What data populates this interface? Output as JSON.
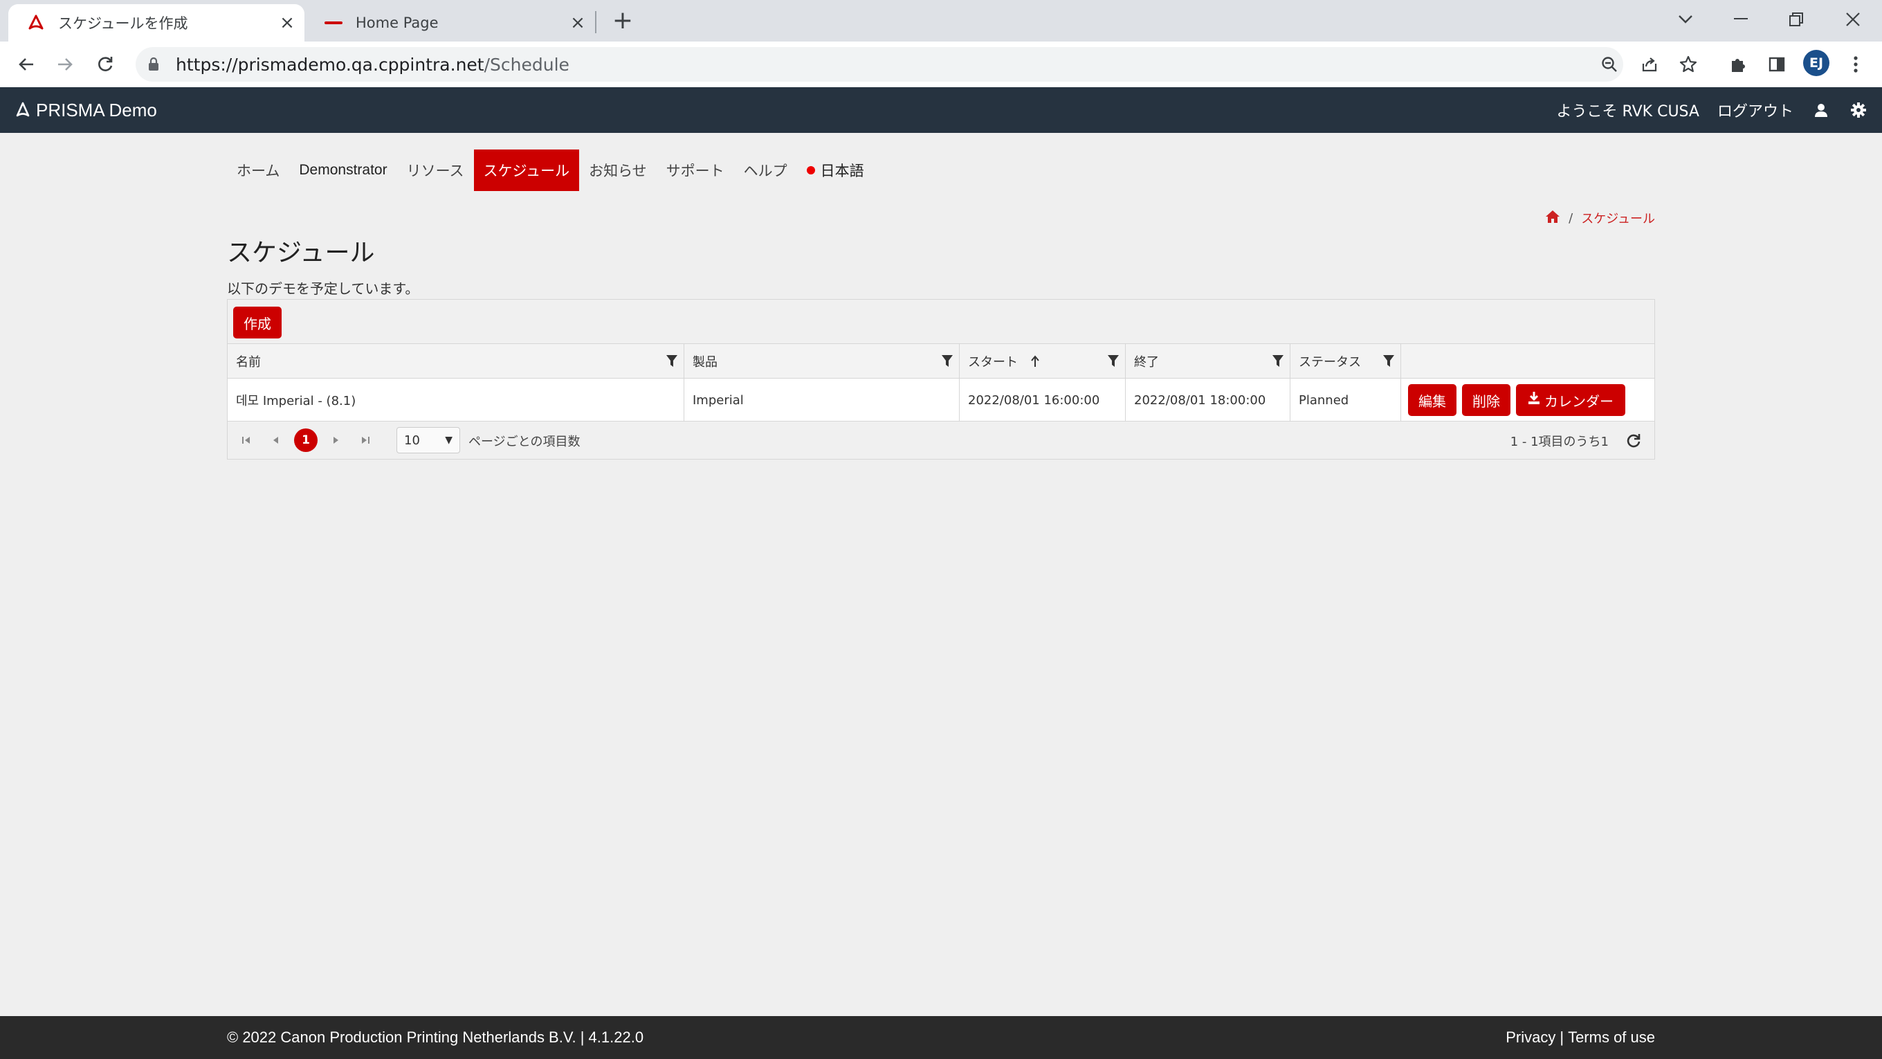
{
  "browser": {
    "tabs": [
      {
        "title": "スケジュールを作成",
        "active": true
      },
      {
        "title": "Home Page",
        "active": false
      }
    ],
    "url_host": "https://prismademo.qa.cppintra.net",
    "url_path": "/Schedule",
    "profile_initials": "EJ"
  },
  "app": {
    "brand": "PRISMA Demo",
    "welcome": "ようこそ RVK CUSA",
    "logout": "ログアウト"
  },
  "menu": {
    "home": "ホーム",
    "demonstrator": "Demonstrator",
    "resources": "リソース",
    "schedule": "スケジュール",
    "news": "お知らせ",
    "support": "サポート",
    "help": "ヘルプ",
    "language": "日本語"
  },
  "breadcrumb": {
    "current": "スケジュール"
  },
  "page": {
    "title": "スケジュール",
    "subtitle": "以下のデモを予定しています。"
  },
  "grid": {
    "create_label": "作成",
    "columns": {
      "name": "名前",
      "product": "製品",
      "start": "スタート",
      "end": "終了",
      "status": "ステータス"
    },
    "rows": [
      {
        "name": "데모 Imperial - (8.1)",
        "product": "Imperial",
        "start": "2022/08/01 16:00:00",
        "end": "2022/08/01 18:00:00",
        "status": "Planned",
        "edit": "編集",
        "delete": "削除",
        "calendar": "カレンダー"
      }
    ],
    "pager": {
      "current_page": "1",
      "page_size": "10",
      "page_size_label": "ページごとの項目数",
      "info": "1 - 1項目のうち1"
    }
  },
  "footer": {
    "copyright": "© 2022 Canon Production Printing Netherlands B.V. | 4.1.22.0",
    "privacy": "Privacy",
    "separator": "|",
    "terms": "Terms of use"
  },
  "colors": {
    "accent": "#cc0000",
    "header_bg": "#263340",
    "footer_bg": "#2a2a2a"
  }
}
